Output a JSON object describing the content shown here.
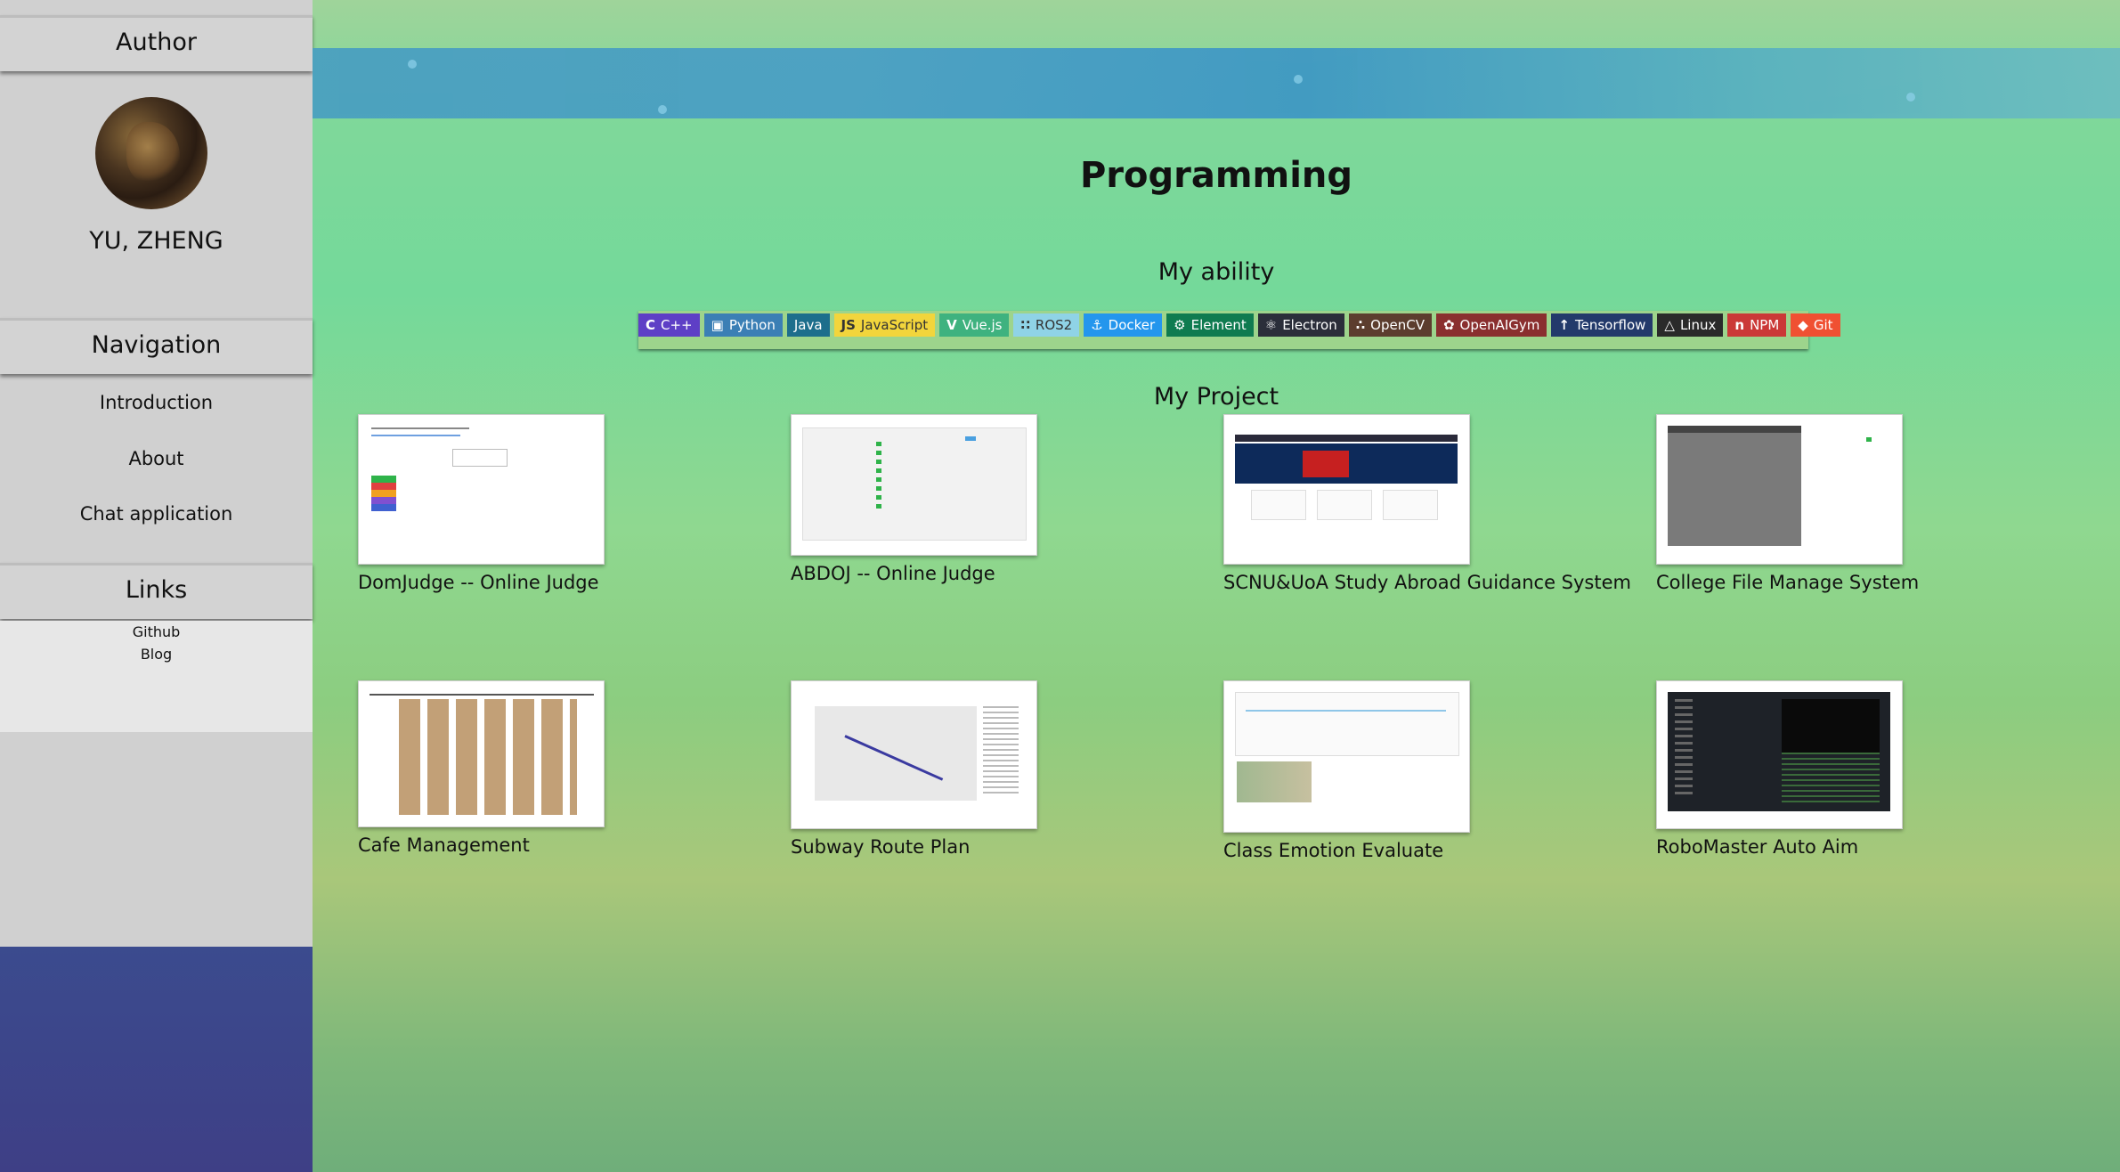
{
  "sidebar": {
    "author_header": "Author",
    "author_name": "YU, ZHENG",
    "navigation_header": "Navigation",
    "nav_items": [
      "Introduction",
      "About",
      "Chat application"
    ],
    "links_header": "Links",
    "links": [
      "Github",
      "Blog"
    ]
  },
  "main": {
    "title": "Programming",
    "ability_title": "My ability",
    "project_title": "My Project"
  },
  "badges": [
    {
      "label": "C++",
      "icon": "cpp-icon",
      "color": "#5e3fc6"
    },
    {
      "label": "Python",
      "icon": "python-icon",
      "color": "#3b7fb5"
    },
    {
      "label": "Java",
      "icon": "java-icon",
      "color": "#1d6e8c"
    },
    {
      "label": "JavaScript",
      "icon": "javascript-icon",
      "color": "#f2d53c"
    },
    {
      "label": "Vue.js",
      "icon": "vuejs-icon",
      "color": "#3fb27f"
    },
    {
      "label": "ROS2",
      "icon": "ros2-icon",
      "color": "#8fd3e6"
    },
    {
      "label": "Docker",
      "icon": "docker-icon",
      "color": "#2496ed"
    },
    {
      "label": "Element",
      "icon": "element-icon",
      "color": "#0f7b50"
    },
    {
      "label": "Electron",
      "icon": "electron-icon",
      "color": "#2b2e3a"
    },
    {
      "label": "OpenCV",
      "icon": "opencv-icon",
      "color": "#5c3d2e"
    },
    {
      "label": "OpenAIGym",
      "icon": "openaigym-icon",
      "color": "#8a2f2f"
    },
    {
      "label": "Tensorflow",
      "icon": "tensorflow-icon",
      "color": "#233a6b"
    },
    {
      "label": "Linux",
      "icon": "linux-icon",
      "color": "#2a2a2a"
    },
    {
      "label": "NPM",
      "icon": "npm-icon",
      "color": "#cb3837"
    },
    {
      "label": "Git",
      "icon": "git-icon",
      "color": "#f05032"
    }
  ],
  "projects": [
    {
      "label": "DomJudge -- Online Judge"
    },
    {
      "label": "ABDOJ -- Online Judge"
    },
    {
      "label": "SCNU&UoA Study Abroad Guidance System"
    },
    {
      "label": "College File Manage System"
    },
    {
      "label": "Cafe Management"
    },
    {
      "label": "Subway Route Plan"
    },
    {
      "label": "Class Emotion Evaluate"
    },
    {
      "label": "RoboMaster Auto Aim"
    }
  ]
}
